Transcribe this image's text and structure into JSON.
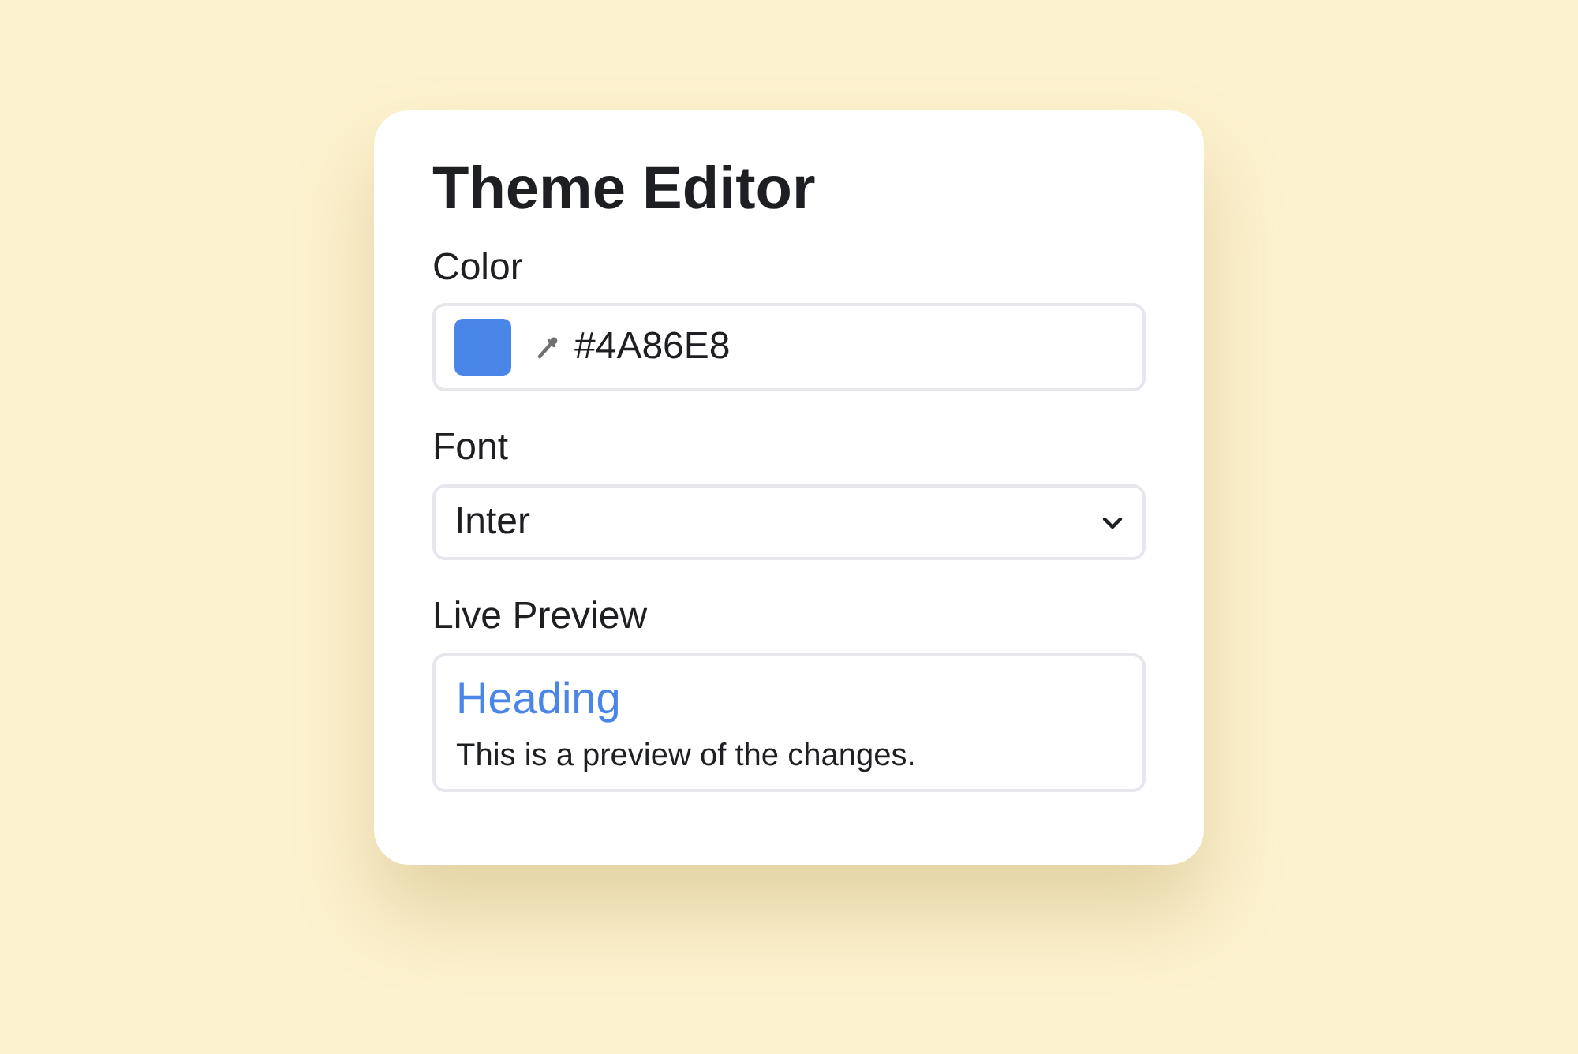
{
  "title": "Theme Editor",
  "color_field": {
    "label": "Color",
    "color": "#4a86e8",
    "value": "#4A86E8"
  },
  "font_field": {
    "label": "Font",
    "value": "Inter"
  },
  "preview": {
    "label": "Live Preview",
    "heading": "Heading",
    "text": "This is a preview of the changes."
  }
}
